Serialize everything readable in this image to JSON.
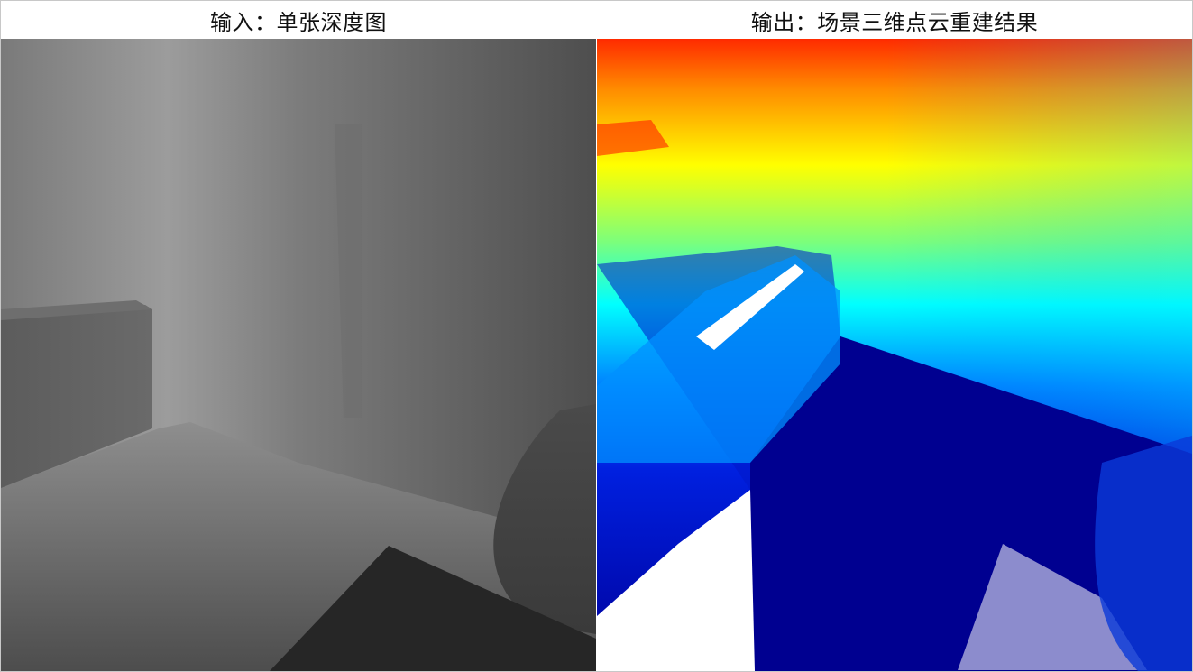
{
  "panels": [
    {
      "caption": "输入：单张深度图"
    },
    {
      "caption": "输出：场景三维点云重建结果"
    }
  ]
}
